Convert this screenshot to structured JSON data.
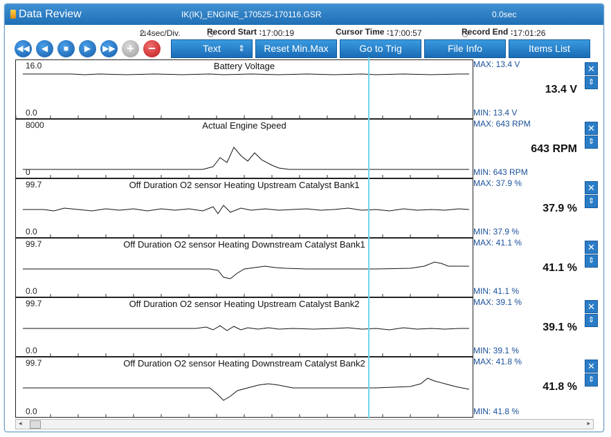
{
  "window": {
    "title": "Data Review",
    "filename": "IK(IK)_ENGINE_170525-170116.GSR",
    "elapsed": "0.0sec"
  },
  "info": {
    "scale": "2.4sec/Div.",
    "record_start_label": "Record Start :",
    "record_start": "17:00:19",
    "cursor_time_label": "Cursor Time :",
    "cursor_time": "17:00:57",
    "record_end_label": "Record End :",
    "record_end": "17:01:26"
  },
  "toolbar": {
    "playback_icons": [
      "rewind-icon",
      "step-back-icon",
      "stop-icon",
      "play-icon",
      "fast-forward-icon"
    ],
    "zoom_in": "+",
    "zoom_out": "−",
    "text_select": "Text",
    "reset_minmax": "Reset Min.Max",
    "goto_trig": "Go to Trig",
    "file_info": "File Info",
    "items_list": "Items List"
  },
  "panels": [
    {
      "title": "Battery Voltage",
      "max_label": "16.0",
      "min_label": "0.0",
      "stat_max": "MAX:  13.4 V",
      "stat_min": "MIN:  13.4 V",
      "current": "13.4 V"
    },
    {
      "title": "Actual Engine Speed",
      "max_label": "8000",
      "min_label": "0",
      "stat_max": "MAX:   643 RPM",
      "stat_min": "MIN:   643 RPM",
      "current": "643 RPM"
    },
    {
      "title": "Off Duration O2 sensor Heating Upstream Catalyst Bank1",
      "max_label": "99.7",
      "min_label": "0.0",
      "stat_max": "MAX:  37.9 %",
      "stat_min": "MIN:  37.9 %",
      "current": "37.9 %"
    },
    {
      "title": "Off Duration O2 sensor Heating Downstream Catalyst Bank1",
      "max_label": "99.7",
      "min_label": "0.0",
      "stat_max": "MAX:  41.1 %",
      "stat_min": "MIN:  41.1 %",
      "current": "41.1 %"
    },
    {
      "title": "Off Duration O2 sensor Heating Upstream Catalyst Bank2",
      "max_label": "99.7",
      "min_label": "0.0",
      "stat_max": "MAX:  39.1 %",
      "stat_min": "MIN:  39.1 %",
      "current": "39.1 %"
    },
    {
      "title": "Off Duration O2 sensor Heating Downstream Catalyst Bank2",
      "max_label": "99.7",
      "min_label": "0.0",
      "stat_max": "MAX:  41.8 %",
      "stat_min": "MIN:  41.8 %",
      "current": "41.8 %"
    }
  ],
  "colors": {
    "accent": "#1f6fb5",
    "cursor": "#6fd7ea",
    "stat_text": "#1a4f9a"
  }
}
